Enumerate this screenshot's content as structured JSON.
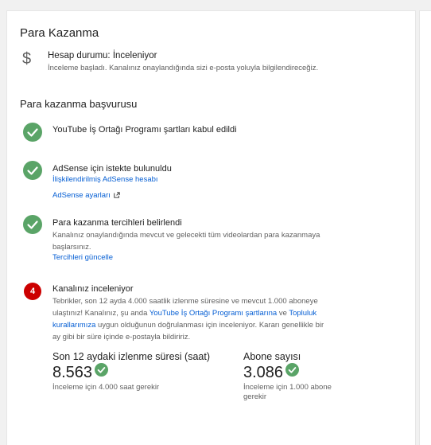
{
  "panel": {
    "title": "Para Kazanma"
  },
  "account_status": {
    "icon": "dollar-icon",
    "label": "Hesap durumu: İnceleniyor",
    "description": "İnceleme başladı. Kanalınız onaylandığında sizi e-posta yoluyla bilgilendireceğiz."
  },
  "application": {
    "title": "Para kazanma başvurusu",
    "steps": [
      {
        "title": "YouTube İş Ortağı Programı şartları kabul edildi"
      },
      {
        "title": "AdSense için istekte bulunuldu",
        "link1": "İlişkilendirilmiş AdSense hesabı",
        "link2": "AdSense ayarları"
      },
      {
        "title": "Para kazanma tercihleri belirlendi",
        "desc_line1": "Kanalınız onaylandığında mevcut ve gelecekti tüm videolardan para kazanmaya",
        "desc_line2": "başlarsınız.",
        "link": "Tercihleri güncelle"
      },
      {
        "number": "4",
        "title": "Kanalınız inceleniyor",
        "desc_line1": "Tebrikler, son 12 ayda 4.000 saatlik izlenme süresine ve mevcut 1.000 aboneye",
        "desc_line2_a": "ulaştınız! Kanalınız, şu anda ",
        "desc_line2_link1": "YouTube İş Ortağı Programı şartlarına",
        "desc_line2_b": " ve ",
        "desc_line2_link2": "Topluluk",
        "desc_line3_link": "kurallarımıza",
        "desc_line3_b": " uygun olduğunun doğrulanması için inceleniyor. Kararı genellikle bir",
        "desc_line4": "ay gibi bir süre içinde e-postayla bildiririz."
      }
    ]
  },
  "stats": {
    "watch_time": {
      "label": "Son 12 aydaki izlenme süresi (saat)",
      "value": "8.563",
      "note": "İnceleme için 4.000 saat gerekir"
    },
    "subscribers": {
      "label": "Abone sayısı",
      "value": "3.086",
      "note_line1": "İnceleme için 1.000 abone",
      "note_line2": "gerekir"
    }
  },
  "colors": {
    "success": "#5aa467",
    "alert": "#cc0000",
    "link": "#065fd4"
  }
}
